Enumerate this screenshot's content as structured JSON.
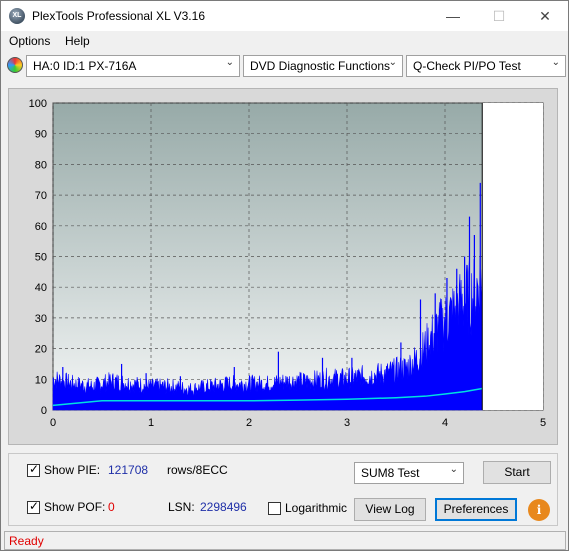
{
  "window": {
    "title": "PlexTools Professional XL V3.16",
    "icon_label": "XL",
    "minimize_glyph": "—",
    "maximize_glyph": "☐",
    "close_glyph": "✕"
  },
  "menu": {
    "options": "Options",
    "help": "Help"
  },
  "toolbar": {
    "drive": "HA:0 ID:1  PX-716A",
    "function": "DVD Diagnostic Functions",
    "test": "Q-Check PI/PO Test"
  },
  "chart_data": {
    "type": "area",
    "title": "",
    "xlabel": "",
    "ylabel": "",
    "xlim": [
      0,
      5
    ],
    "ylim": [
      0,
      100
    ],
    "x_ticks": [
      "0",
      "1",
      "2",
      "3",
      "4",
      "5"
    ],
    "y_ticks": [
      "0",
      "10",
      "20",
      "30",
      "40",
      "50",
      "60",
      "70",
      "80",
      "90",
      "100"
    ],
    "grid": true,
    "end_marker_x": 4.38,
    "series": [
      {
        "name": "PIE",
        "color": "#0000ff",
        "points": [
          [
            0,
            12
          ],
          [
            0.2,
            10
          ],
          [
            0.4,
            9
          ],
          [
            0.6,
            11
          ],
          [
            0.8,
            10
          ],
          [
            1,
            9
          ],
          [
            1.2,
            9
          ],
          [
            1.4,
            8
          ],
          [
            1.6,
            9
          ],
          [
            1.8,
            10
          ],
          [
            2,
            10
          ],
          [
            2.2,
            10
          ],
          [
            2.4,
            11
          ],
          [
            2.6,
            11
          ],
          [
            2.8,
            12
          ],
          [
            3,
            12
          ],
          [
            3.2,
            13
          ],
          [
            3.4,
            14
          ],
          [
            3.6,
            16
          ],
          [
            3.7,
            19
          ],
          [
            3.8,
            24
          ],
          [
            3.9,
            30
          ],
          [
            4,
            34
          ],
          [
            4.1,
            38
          ],
          [
            4.2,
            42
          ],
          [
            4.3,
            44
          ],
          [
            4.36,
            50
          ],
          [
            4.38,
            48
          ]
        ]
      },
      {
        "name": "PIE peaks",
        "color": "#0000ff",
        "points": [
          [
            0.1,
            14
          ],
          [
            0.7,
            15
          ],
          [
            0.95,
            12
          ],
          [
            1.3,
            11
          ],
          [
            1.85,
            14
          ],
          [
            2.3,
            19
          ],
          [
            2.75,
            17
          ],
          [
            3.05,
            17
          ],
          [
            3.55,
            22
          ],
          [
            3.75,
            36
          ],
          [
            3.9,
            38
          ],
          [
            4.02,
            43
          ],
          [
            4.12,
            46
          ],
          [
            4.2,
            50
          ],
          [
            4.25,
            63
          ],
          [
            4.3,
            57
          ],
          [
            4.36,
            74
          ]
        ]
      },
      {
        "name": "POF",
        "color": "#00e0e0",
        "points": [
          [
            0,
            1.5
          ],
          [
            0.5,
            3
          ],
          [
            1,
            3
          ],
          [
            1.5,
            3
          ],
          [
            2,
            3
          ],
          [
            2.5,
            3.2
          ],
          [
            3,
            3.5
          ],
          [
            3.5,
            4
          ],
          [
            3.8,
            4.5
          ],
          [
            4,
            5.2
          ],
          [
            4.2,
            6
          ],
          [
            4.38,
            7
          ]
        ]
      }
    ]
  },
  "panel": {
    "show_pie_label": "Show PIE:",
    "pie_value": "121708",
    "pie_unit": "rows/8ECC",
    "show_pof_label": "Show POF:",
    "pof_value": "0",
    "lsn_label": "LSN:",
    "lsn_value": "2298496",
    "logarithmic_label": "Logarithmic",
    "test_select": "SUM8 Test",
    "start_button": "Start",
    "view_log_button": "View Log",
    "preferences_button": "Preferences",
    "info_glyph": "i",
    "check_mark": "✓"
  },
  "status": {
    "text": "Ready"
  }
}
